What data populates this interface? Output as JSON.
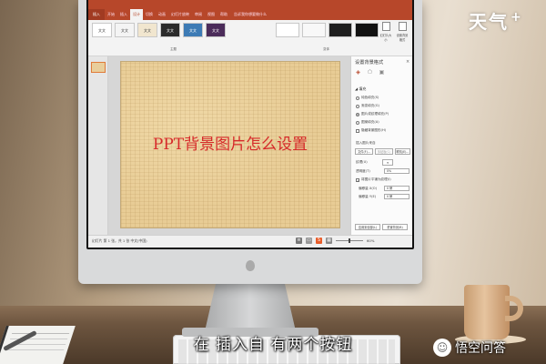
{
  "watermark": {
    "text": "天气",
    "symbol": "+"
  },
  "powerpoint": {
    "file_tab": "插入",
    "tabs": [
      "开始",
      "插入",
      "设计",
      "切换",
      "动画",
      "幻灯片放映",
      "审阅",
      "视图",
      "帮助"
    ],
    "active_tab": "设计",
    "tell_me": "告诉我你想要做什么",
    "theme_thumbnails": [
      "文文",
      "文文",
      "文文",
      "文文",
      "文文",
      "文文"
    ],
    "group_theme_label": "主题",
    "group_variant_label": "变体",
    "ribbon_buttons": [
      "幻灯片大小",
      "设置背景格式"
    ],
    "slide": {
      "title": "PPT背景图片怎么设置"
    },
    "format_pane": {
      "title": "设置背景格式",
      "close": "×",
      "icons": [
        "fill-icon",
        "effects-icon",
        "picture-icon"
      ],
      "section": "◢ 填充",
      "fill_options": [
        {
          "label": "纯色填充(S)",
          "selected": false
        },
        {
          "label": "渐变填充(G)",
          "selected": false
        },
        {
          "label": "图片或纹理填充(P)",
          "selected": true
        },
        {
          "label": "图案填充(A)",
          "selected": false
        }
      ],
      "hide_graphics": "隐藏背景图形(H)",
      "insert_from": "插入图片来自",
      "btn_file": "文件(F)...",
      "btn_clipboard": "剪贴板(C)",
      "btn_online": "联机(E)...",
      "texture_label": "纹理(U)",
      "transparency_label": "透明度(T)",
      "transparency_value": "0%",
      "tile_label": "将图片平铺为纹理(I)",
      "offset_x_label": "偏移量 X(O)",
      "offset_x_value": "0 磅",
      "offset_y_label": "偏移量 Y(E)",
      "offset_y_value": "0 磅",
      "apply_all": "应用到全部(L)",
      "reset_bg": "重置背景(B)"
    },
    "status": {
      "left": "幻灯片 第 1 张，共 1 张    中文(中国)",
      "zoom_value": "60%"
    }
  },
  "subtitle": "在 插入自 有两个按钮",
  "source_badge": "悟空问答"
}
